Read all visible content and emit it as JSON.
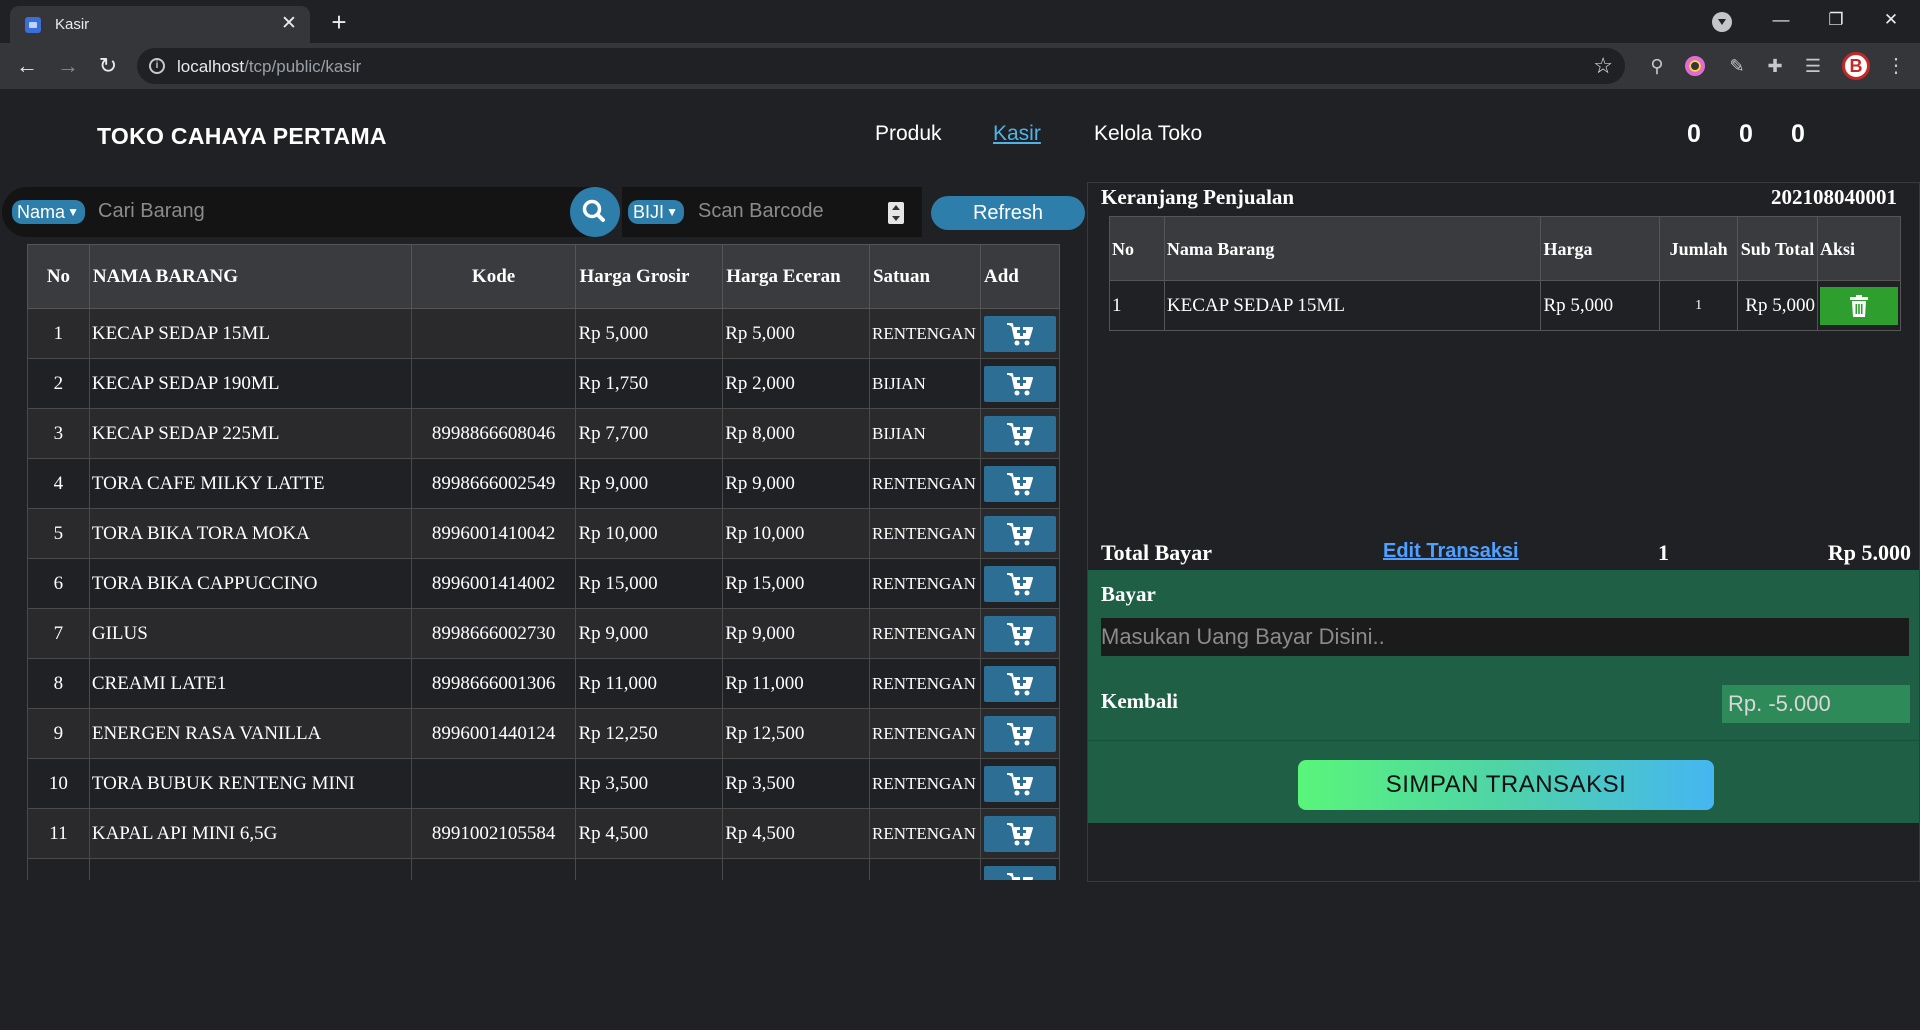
{
  "browser": {
    "tab_title": "Kasir",
    "url_host": "localhost",
    "url_path": "/tcp/public/kasir"
  },
  "header": {
    "brand": "TOKO CAHAYA PERTAMA",
    "nav": [
      "Produk",
      "Kasir",
      "Kelola Toko"
    ],
    "active_nav": "Kasir",
    "counters": [
      "0",
      "0",
      "0"
    ]
  },
  "search": {
    "filter_selected": "Nama",
    "placeholder": "Cari Barang",
    "unit_selected": "BIJI",
    "barcode_placeholder": "Scan Barcode",
    "refresh_label": "Refresh"
  },
  "products": {
    "columns": [
      "No",
      "NAMA BARANG",
      "Kode",
      "Harga Grosir",
      "Harga Eceran",
      "Satuan",
      "Add"
    ],
    "rows": [
      {
        "no": "1",
        "name": "KECAP SEDAP 15ML",
        "code": "",
        "grosir": "Rp 5,000",
        "eceran": "Rp 5,000",
        "unit": "RENTENGAN"
      },
      {
        "no": "2",
        "name": "KECAP SEDAP 190ML",
        "code": "",
        "grosir": "Rp 1,750",
        "eceran": "Rp 2,000",
        "unit": "BIJIAN"
      },
      {
        "no": "3",
        "name": "KECAP SEDAP 225ML",
        "code": "8998866608046",
        "grosir": "Rp 7,700",
        "eceran": "Rp 8,000",
        "unit": "BIJIAN"
      },
      {
        "no": "4",
        "name": "TORA CAFE MILKY LATTE",
        "code": "8998666002549",
        "grosir": "Rp 9,000",
        "eceran": "Rp 9,000",
        "unit": "RENTENGAN"
      },
      {
        "no": "5",
        "name": "TORA BIKA TORA MOKA",
        "code": "8996001410042",
        "grosir": "Rp 10,000",
        "eceran": "Rp 10,000",
        "unit": "RENTENGAN"
      },
      {
        "no": "6",
        "name": "TORA BIKA CAPPUCCINO",
        "code": "8996001414002",
        "grosir": "Rp 15,000",
        "eceran": "Rp 15,000",
        "unit": "RENTENGAN"
      },
      {
        "no": "7",
        "name": "GILUS",
        "code": "8998666002730",
        "grosir": "Rp 9,000",
        "eceran": "Rp 9,000",
        "unit": "RENTENGAN"
      },
      {
        "no": "8",
        "name": "CREAMI LATE1",
        "code": "8998666001306",
        "grosir": "Rp 11,000",
        "eceran": "Rp 11,000",
        "unit": "RENTENGAN"
      },
      {
        "no": "9",
        "name": "ENERGEN RASA VANILLA",
        "code": "8996001440124",
        "grosir": "Rp 12,250",
        "eceran": "Rp 12,500",
        "unit": "RENTENGAN"
      },
      {
        "no": "10",
        "name": "TORA BUBUK RENTENG MINI",
        "code": "",
        "grosir": "Rp 3,500",
        "eceran": "Rp 3,500",
        "unit": "RENTENGAN"
      },
      {
        "no": "11",
        "name": "KAPAL API MINI 6,5G",
        "code": "8991002105584",
        "grosir": "Rp 4,500",
        "eceran": "Rp 4,500",
        "unit": "RENTENGAN"
      }
    ]
  },
  "cart": {
    "title": "Keranjang Penjualan",
    "transaction_code": "202108040001",
    "columns": [
      "No",
      "Nama Barang",
      "Harga",
      "Jumlah",
      "Sub Total",
      "Aksi"
    ],
    "rows": [
      {
        "no": "1",
        "name": "KECAP SEDAP 15ML",
        "price": "Rp 5,000",
        "qty": "1",
        "subtotal": "Rp 5,000"
      }
    ],
    "total_label": "Total Bayar",
    "edit_label": "Edit Transaksi",
    "total_qty": "1",
    "total_amount": "Rp 5.000",
    "pay_label": "Bayar",
    "pay_placeholder": "Masukan Uang Bayar Disini..",
    "change_label": "Kembali",
    "change_value": "Rp. -5.000",
    "save_label": "SIMPAN TRANSAKSI"
  },
  "colors": {
    "accent": "#2d7eaa",
    "pay_panel": "#1e5f46",
    "delete": "#2e9e2e"
  }
}
